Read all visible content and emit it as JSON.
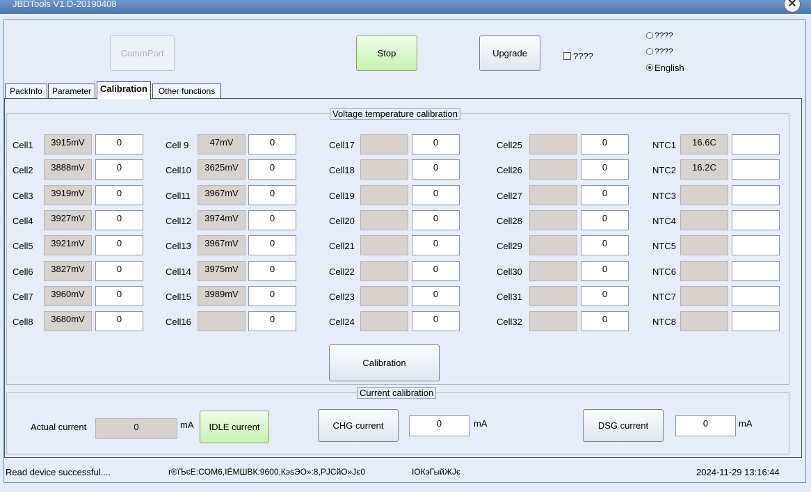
{
  "window": {
    "title": "JBDTools V1.D-20190408"
  },
  "toolbar": {
    "commport_label": "CommPort",
    "stop_label": "Stop",
    "upgrade_label": "Upgrade",
    "checkbox_label": "????"
  },
  "language": {
    "options": [
      "????",
      "????",
      "English"
    ],
    "selected": "English"
  },
  "tabs": [
    "PackInfo",
    "Parameter",
    "Calibration",
    "Other functions"
  ],
  "active_tab": "Calibration",
  "voltage_group": {
    "title": "Voltage temperature calibration",
    "columns": [
      {
        "cells": [
          {
            "label": "Cell1",
            "value": "3915mV",
            "input": "0"
          },
          {
            "label": "Cell2",
            "value": "3888mV",
            "input": "0"
          },
          {
            "label": "Cell3",
            "value": "3919mV",
            "input": "0"
          },
          {
            "label": "Cell4",
            "value": "3927mV",
            "input": "0"
          },
          {
            "label": "Cell5",
            "value": "3921mV",
            "input": "0"
          },
          {
            "label": "Cell6",
            "value": "3827mV",
            "input": "0"
          },
          {
            "label": "Cell7",
            "value": "3960mV",
            "input": "0"
          },
          {
            "label": "Cell8",
            "value": "3680mV",
            "input": "0"
          }
        ]
      },
      {
        "cells": [
          {
            "label": "Cell 9",
            "value": "47mV",
            "input": "0"
          },
          {
            "label": "Cell10",
            "value": "3625mV",
            "input": "0"
          },
          {
            "label": "Cell11",
            "value": "3967mV",
            "input": "0"
          },
          {
            "label": "Cell12",
            "value": "3974mV",
            "input": "0"
          },
          {
            "label": "Cell13",
            "value": "3967mV",
            "input": "0"
          },
          {
            "label": "Cell14",
            "value": "3975mV",
            "input": "0"
          },
          {
            "label": "Cell15",
            "value": "3989mV",
            "input": "0"
          },
          {
            "label": "Cell16",
            "value": "",
            "input": "0"
          }
        ]
      },
      {
        "cells": [
          {
            "label": "Cell17",
            "value": "",
            "input": "0"
          },
          {
            "label": "Cell18",
            "value": "",
            "input": "0"
          },
          {
            "label": "Cell19",
            "value": "",
            "input": "0"
          },
          {
            "label": "Cell20",
            "value": "",
            "input": "0"
          },
          {
            "label": "Cell21",
            "value": "",
            "input": "0"
          },
          {
            "label": "Cell22",
            "value": "",
            "input": "0"
          },
          {
            "label": "Cell23",
            "value": "",
            "input": "0"
          },
          {
            "label": "Cell24",
            "value": "",
            "input": "0"
          }
        ]
      },
      {
        "cells": [
          {
            "label": "Cell25",
            "value": "",
            "input": "0"
          },
          {
            "label": "Cell26",
            "value": "",
            "input": "0"
          },
          {
            "label": "Cell27",
            "value": "",
            "input": "0"
          },
          {
            "label": "Cell28",
            "value": "",
            "input": "0"
          },
          {
            "label": "Cell29",
            "value": "",
            "input": "0"
          },
          {
            "label": "Cell30",
            "value": "",
            "input": "0"
          },
          {
            "label": "Cell31",
            "value": "",
            "input": "0"
          },
          {
            "label": "Cell32",
            "value": "",
            "input": "0"
          }
        ]
      },
      {
        "cells": [
          {
            "label": "NTC1",
            "value": "16.6C",
            "input": ""
          },
          {
            "label": "NTC2",
            "value": "16.2C",
            "input": ""
          },
          {
            "label": "NTC3",
            "value": "",
            "input": ""
          },
          {
            "label": "NTC4",
            "value": "",
            "input": ""
          },
          {
            "label": "NTC5",
            "value": "",
            "input": ""
          },
          {
            "label": "NTC6",
            "value": "",
            "input": ""
          },
          {
            "label": "NTC7",
            "value": "",
            "input": ""
          },
          {
            "label": "NTC8",
            "value": "",
            "input": ""
          }
        ]
      }
    ],
    "calibration_button": "Calibration"
  },
  "current_group": {
    "title": "Current calibration",
    "actual_label": "Actual current",
    "actual_value": "0",
    "unit": "mA",
    "idle_button": "IDLE current",
    "chg_button": "CHG current",
    "chg_value": "0",
    "dsg_button": "DSG current",
    "dsg_value": "0"
  },
  "status_bar": {
    "message": "Read device successful....",
    "port_info": "r®ïЪєЕ:COM6,ІЁМШВК:9600,КэѕЭО»:8,РЈСйО»Јє0",
    "state": "ІОКэГыйЖЈє",
    "datetime": "2024-11-29 13:16:44"
  }
}
